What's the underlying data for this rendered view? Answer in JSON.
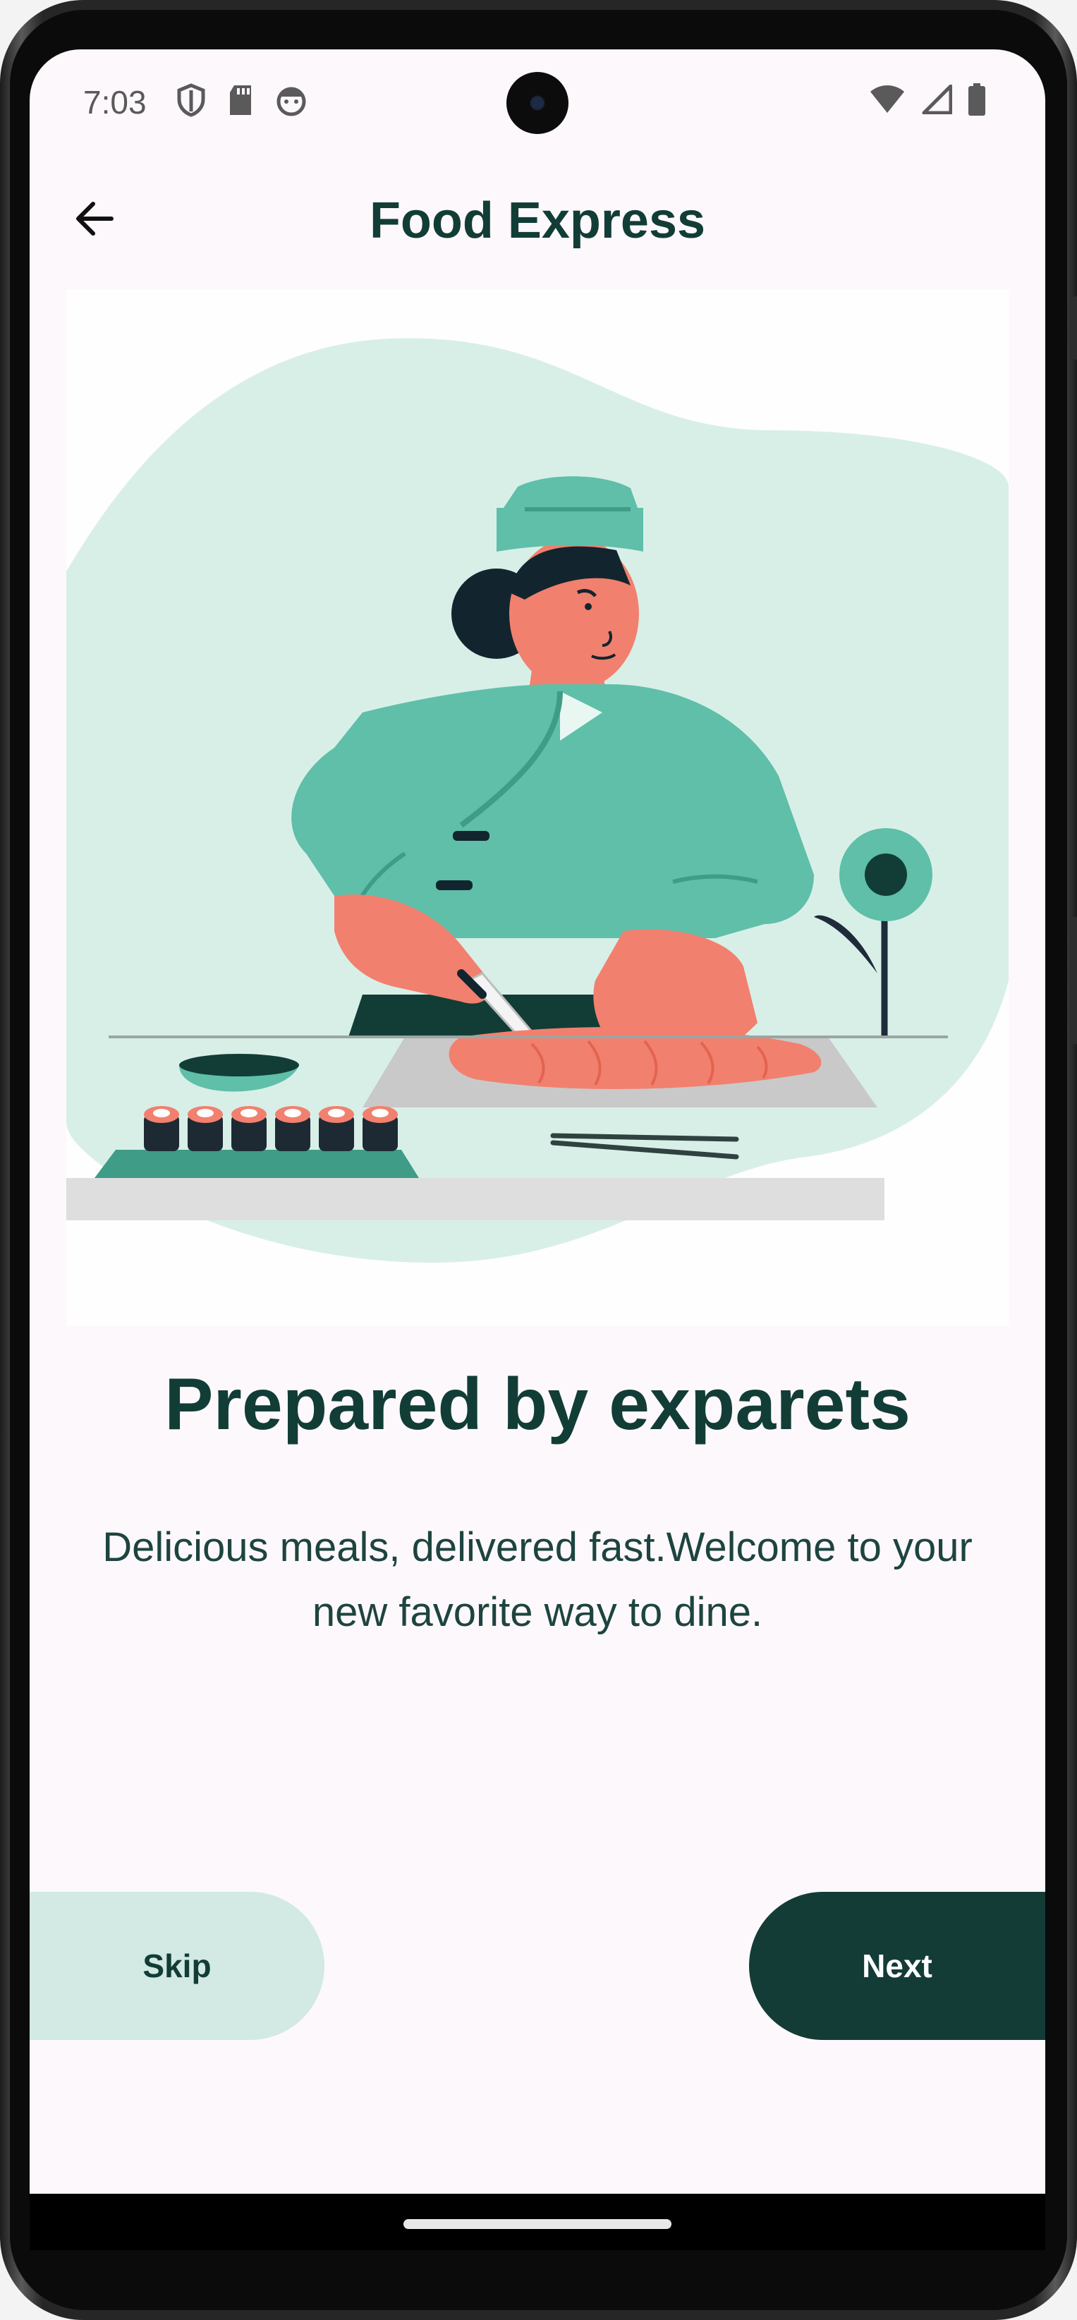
{
  "status_bar": {
    "time": "7:03",
    "left_icons": [
      "shield-icon",
      "sd-card-icon",
      "face-icon"
    ],
    "right_icons": [
      "wifi-icon",
      "cell-signal-icon",
      "battery-icon"
    ]
  },
  "app_bar": {
    "back_icon": "arrow-left-icon",
    "title": "Food Express"
  },
  "onboarding": {
    "illustration": "chef-preparing-sushi-illustration",
    "headline": "Prepared by exparets",
    "body": "Delicious meals, delivered fast.Welcome to your new favorite way to dine."
  },
  "actions": {
    "skip_label": "Skip",
    "next_label": "Next"
  },
  "colors": {
    "primary": "#133c37",
    "secondary_container": "#d3e9e4",
    "background": "#fdf8fb",
    "illustration_green": "#5fbfa9",
    "illustration_bg": "#d8efe8",
    "salmon": "#f2806e"
  }
}
